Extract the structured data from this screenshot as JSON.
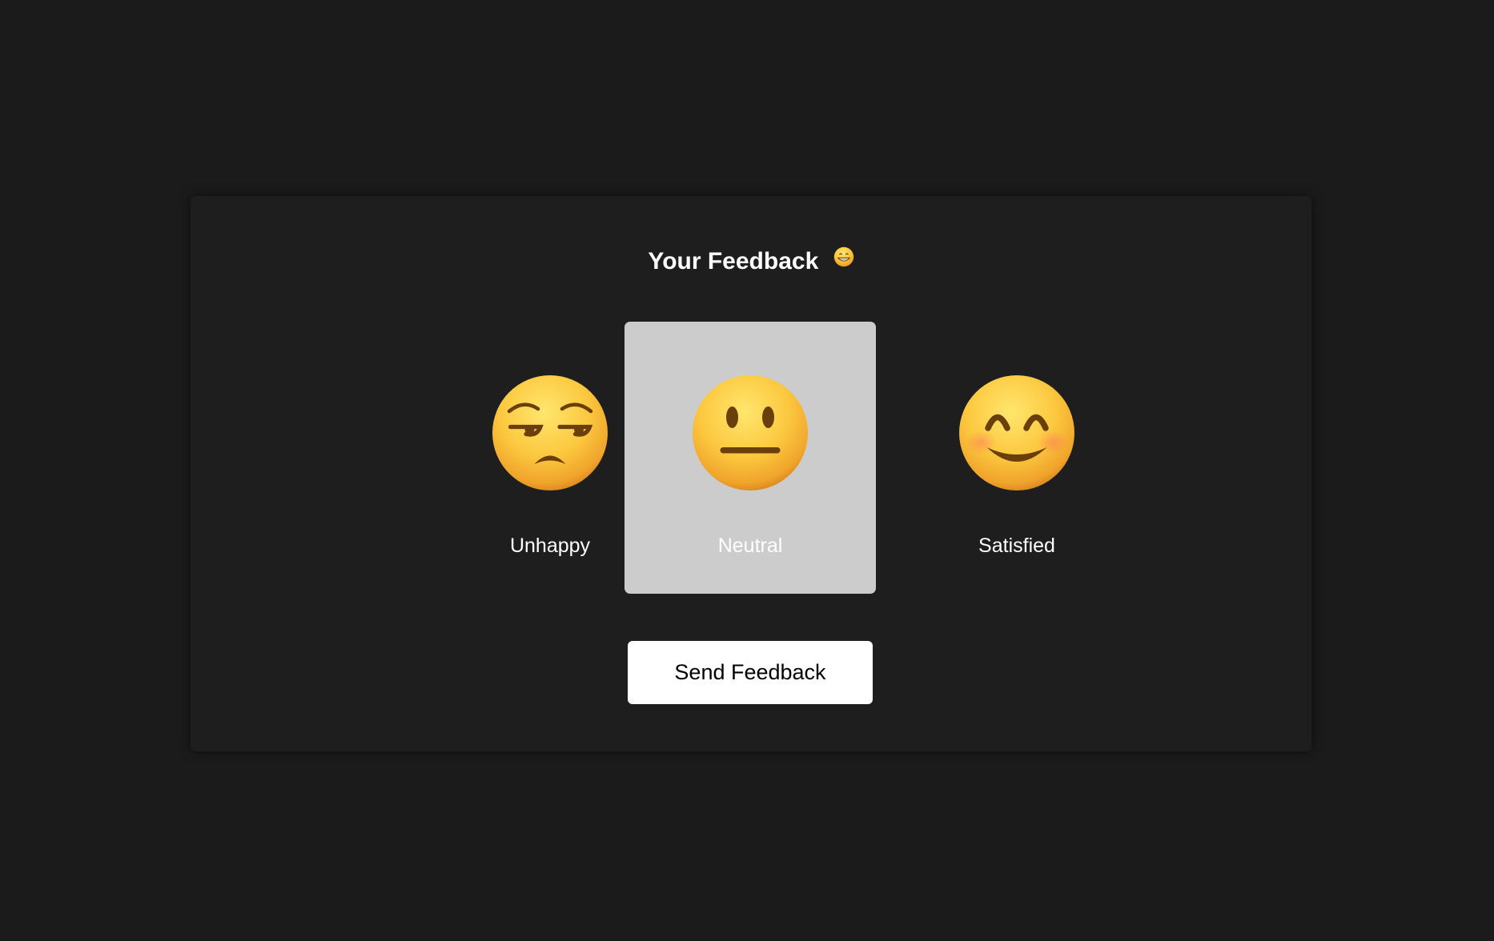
{
  "header": {
    "title": "Your Feedback",
    "title_icon": "grinning-face-icon"
  },
  "options": [
    {
      "label": "Unhappy",
      "icon": "unamused-face-icon",
      "selected": false
    },
    {
      "label": "Neutral",
      "icon": "neutral-face-icon",
      "selected": true
    },
    {
      "label": "Satisfied",
      "icon": "smiling-face-icon",
      "selected": false
    }
  ],
  "actions": {
    "send_label": "Send Feedback"
  },
  "colors": {
    "page_background": "#1b1b1b",
    "panel_background": "#1e1e1e",
    "selected_background": "#cccccc",
    "button_background": "#ffffff",
    "emoji_yellow": "#fcc83f"
  }
}
